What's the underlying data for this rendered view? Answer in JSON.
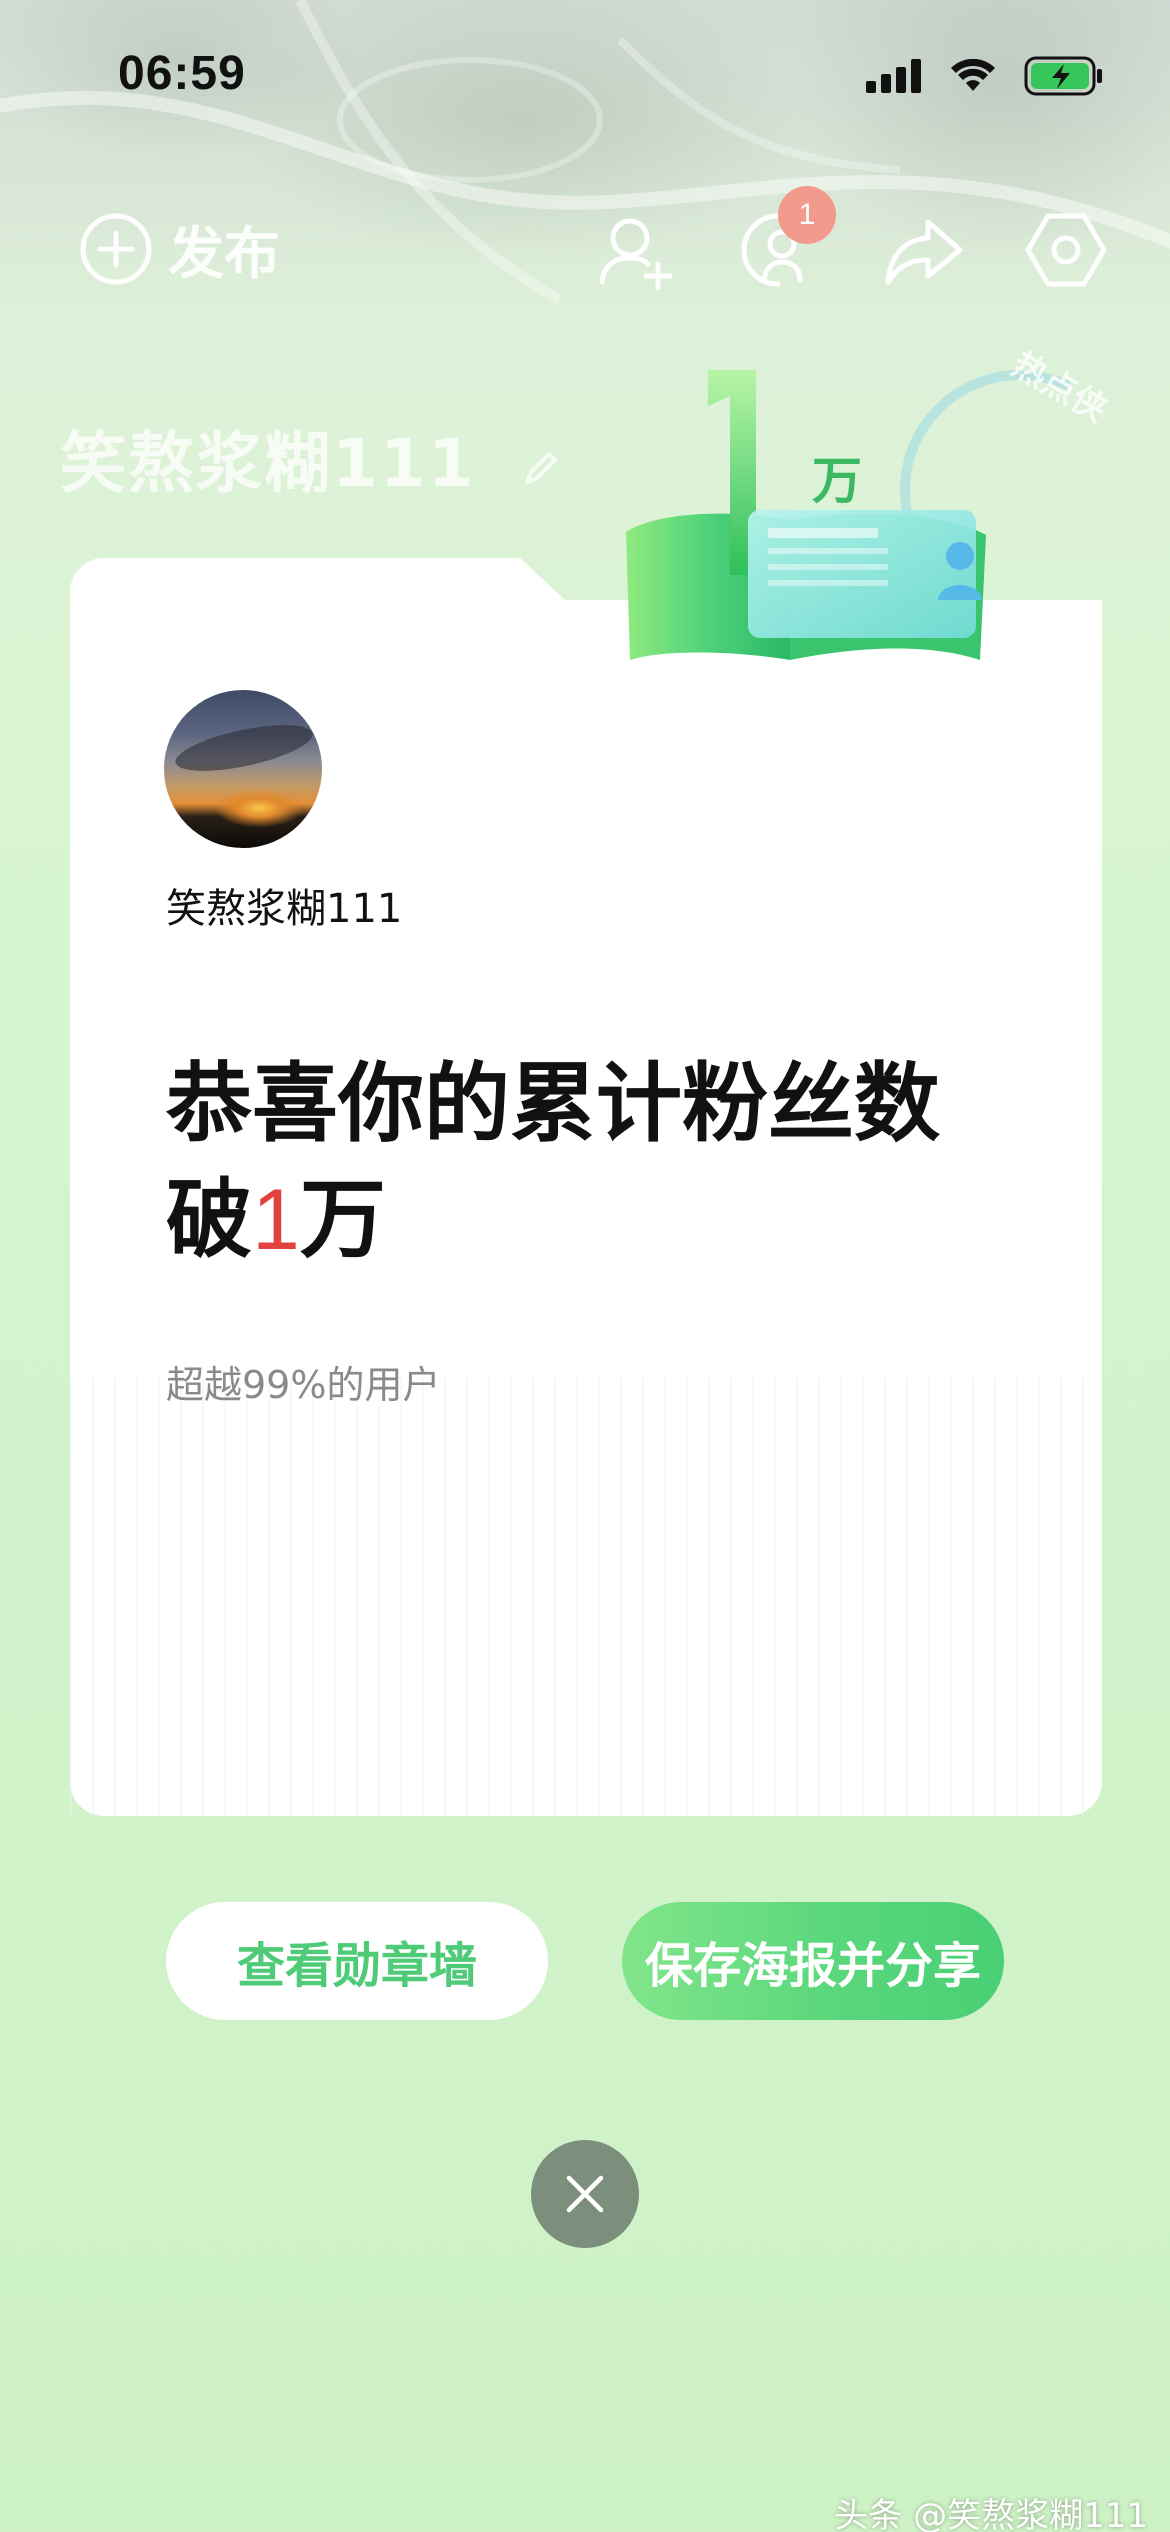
{
  "status_bar": {
    "time": "06:59",
    "icons": [
      "signal-icon",
      "wifi-icon",
      "battery-charging-icon"
    ]
  },
  "header": {
    "publish_label": "发布",
    "message_badge": "1",
    "icons": [
      "plus-circle-icon",
      "add-friend-icon",
      "messages-icon",
      "share-icon",
      "settings-icon"
    ]
  },
  "background": {
    "username": "笑熬浆糊111",
    "stamp_text": "热点侠"
  },
  "badge_art": {
    "number": "1",
    "unit": "万"
  },
  "card": {
    "username": "笑熬浆糊111",
    "headline_line1": "恭喜你的累计粉丝数",
    "headline_prefix": "破",
    "headline_number": "1",
    "headline_suffix": "万",
    "sub_stat": "超越99%的用户"
  },
  "actions": {
    "view_badge_wall": "查看勋章墙",
    "save_share": "保存海报并分享"
  },
  "watermark": "头条 @笑熬浆糊111",
  "colors": {
    "accent_green": "#4fcb78",
    "highlight_red": "#e2423d",
    "badge_red": "#f29a8c",
    "close_bg": "#7c8f7c"
  }
}
